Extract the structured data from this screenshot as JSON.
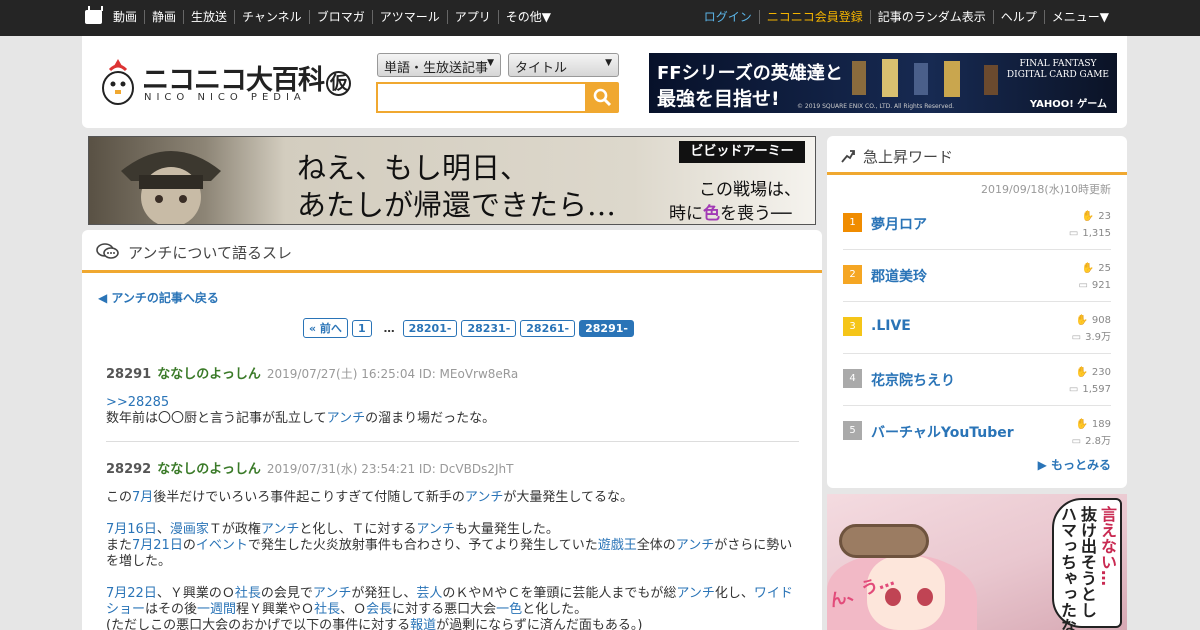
{
  "topnav": {
    "left": [
      "動画",
      "静画",
      "生放送",
      "チャンネル",
      "ブロマガ",
      "アツマール",
      "アプリ",
      "その他▼"
    ],
    "login": "ログイン",
    "register": "ニコニコ会員登録",
    "right": [
      "記事のランダム表示",
      "ヘルプ",
      "メニュー▼"
    ]
  },
  "logo": {
    "main": "ニコニコ大百科",
    "saku": "仮",
    "sub": "NICO NICO PEDIA"
  },
  "search": {
    "scope": "単語・生放送記事",
    "field": "タイトル",
    "value": ""
  },
  "ff_ad": {
    "line1": "FFシリーズの英雄達と",
    "line2": "最強を目指せ!",
    "brand": "FINAL FANTASY\nDIGITAL CARD GAME",
    "sponsor": "YAHOO! ゲーム",
    "copyright": "© 2019 SQUARE ENIX CO., LTD. All Rights Reserved."
  },
  "banner_left": {
    "line1": "ねえ、もし明日、",
    "line2": "あたしが帰還できたら…",
    "brand": "ビビッドアーミー",
    "right1": "この戦場は、",
    "right2a": "時に",
    "right2b": "色",
    "right2c": "を喪う──"
  },
  "thread": {
    "title": "アンチについて語るスレ",
    "back": "アンチの記事へ戻る",
    "pages": [
      "« 前へ",
      "1",
      "…",
      "28201-",
      "28231-",
      "28261-",
      "28291-"
    ],
    "posts": [
      {
        "num": "28291",
        "name": "ななしのよっしん",
        "date": "2019/07/27(土) 16:25:04 ID: MEoVrw8eRa",
        "reply": ">>28285",
        "t1": "数年前は〇〇厨と言う記事が乱立して",
        "l1": "アンチ",
        "t2": "の溜まり場だったな。"
      },
      {
        "num": "28292",
        "name": "ななしのよっしん",
        "date": "2019/07/31(水) 23:54:21 ID: DcVBDs2JhT",
        "p1a": "この",
        "p1l1": "7月",
        "p1b": "後半だけでいろいろ事件起こりすぎて付随して新手の",
        "p1l2": "アンチ",
        "p1c": "が大量発生してるな。",
        "p2l1": "7月16日",
        "p2a": "、",
        "p2l2": "漫画家",
        "p2b": "Ｔが政権",
        "p2l3": "アンチ",
        "p2c": "と化し、Ｔに対する",
        "p2l4": "アンチ",
        "p2d": "も大量発生した。",
        "p3a": "また",
        "p3l1": "7月21日",
        "p3b": "の",
        "p3l2": "イベント",
        "p3c": "で発生した火炎放射事件も合わさり、予てより発生していた",
        "p3l3": "遊戯王",
        "p3d": "全体の",
        "p3l4": "アンチ",
        "p3e": "がさらに勢いを増した。",
        "p4l1": "7月22日",
        "p4a": "、Ｙ興業のＯ",
        "p4l2": "社長",
        "p4b": "の会見で",
        "p4l3": "アンチ",
        "p4c": "が発狂し、",
        "p4l4": "芸人",
        "p4d": "のＫやＭやＣを筆頭に芸能人までもが総",
        "p4l5": "アンチ",
        "p4e": "化し、",
        "p4l6": "ワイドショー",
        "p4f": "はその後",
        "p4l7": "一週間",
        "p4g": "程Ｙ興業やＯ",
        "p4l8": "社長",
        "p4h": "、Ｏ",
        "p4l9": "会長",
        "p4i": "に対する悪口大会",
        "p4l10": "一色",
        "p4j": "と化した。",
        "p5a": "(ただしこの悪口大会のおかげで以下の事件に対する",
        "p5l1": "報道",
        "p5b": "が過剰にならずに済んだ面もある。)"
      }
    ]
  },
  "trending": {
    "title": "急上昇ワード",
    "updated": "2019/09/18(水)10時更新",
    "items": [
      {
        "rank": "1",
        "word": "夢月ロア",
        "a": "23",
        "b": "1,315",
        "color": "#f08c00"
      },
      {
        "rank": "2",
        "word": "郡道美玲",
        "a": "25",
        "b": "921",
        "color": "#f5a623"
      },
      {
        "rank": "3",
        "word": ".LIVE",
        "a": "908",
        "b": "3.9万",
        "color": "#f5c518"
      },
      {
        "rank": "4",
        "word": "花京院ちえり",
        "a": "230",
        "b": "1,597",
        "color": "#aaaaaa"
      },
      {
        "rank": "5",
        "word": "バーチャルYouTuber",
        "a": "189",
        "b": "2.8万",
        "color": "#aaaaaa"
      }
    ],
    "more": "もっとみる"
  },
  "banner_right": {
    "v1": "言えない…",
    "v2": "抜け出そうとし",
    "v3": "ハマっちゃったな",
    "n": "ん、う…"
  }
}
